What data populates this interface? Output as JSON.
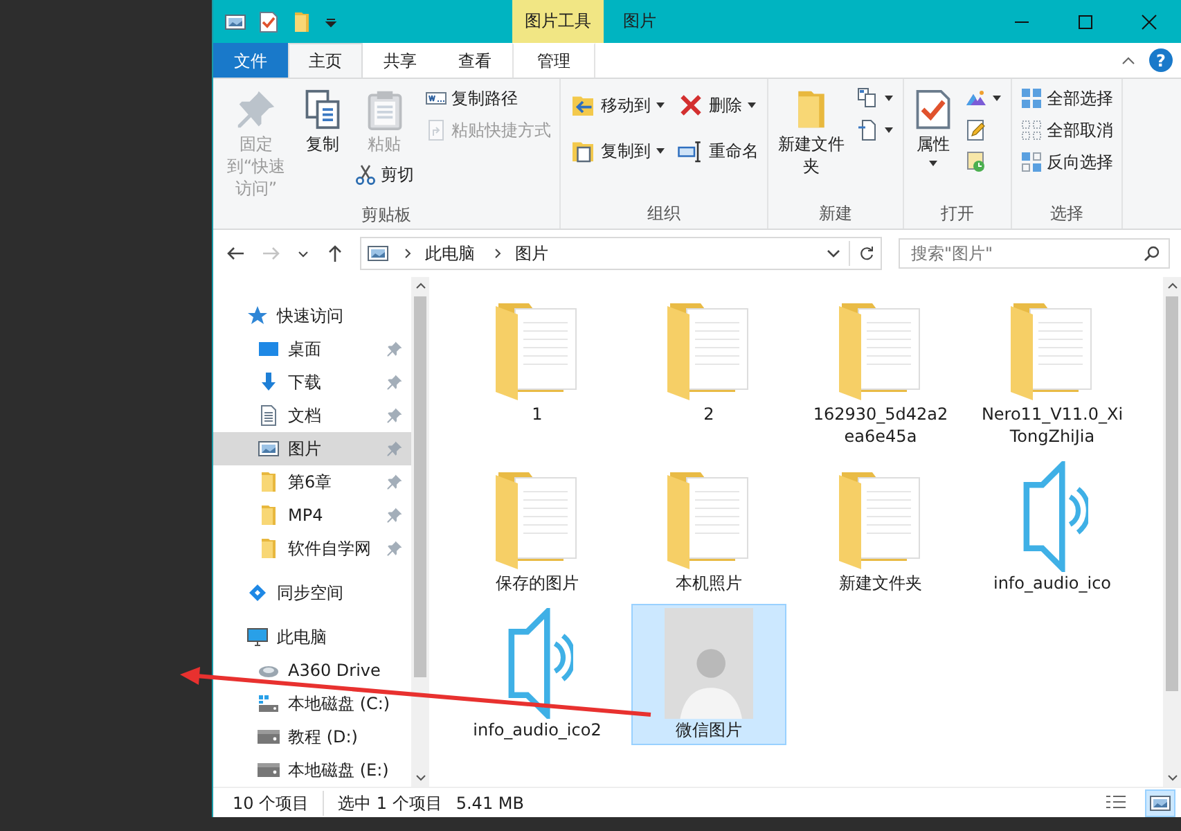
{
  "window": {
    "title": "图片",
    "context_tab": "图片工具"
  },
  "ribbon_tabs": [
    {
      "label": "文件",
      "kind": "file",
      "selected": false
    },
    {
      "label": "主页",
      "kind": "normal",
      "selected": true
    },
    {
      "label": "共享",
      "kind": "normal",
      "selected": false
    },
    {
      "label": "查看",
      "kind": "normal",
      "selected": false
    },
    {
      "label": "管理",
      "kind": "context",
      "selected": false
    }
  ],
  "help_button": {
    "label": "?"
  },
  "ribbon_groups": [
    {
      "label": "剪贴板",
      "columns": [
        [
          {
            "label": "固定到“快速访问”",
            "kind": "large",
            "disabled": true,
            "dropdown": false
          }
        ],
        [
          {
            "label": "复制",
            "kind": "large",
            "disabled": false,
            "dropdown": false
          }
        ],
        [
          {
            "label": "粘贴",
            "kind": "large",
            "disabled": true,
            "dropdown": false
          },
          {
            "label": "剪切",
            "kind": "small",
            "disabled": false,
            "dropdown": false
          }
        ],
        [
          {
            "label": "复制路径",
            "kind": "small",
            "disabled": false,
            "dropdown": false
          },
          {
            "label": "粘贴快捷方式",
            "kind": "small",
            "disabled": true,
            "dropdown": false
          }
        ]
      ]
    },
    {
      "label": "组织",
      "columns": [
        [
          {
            "label": "移动到",
            "kind": "medium",
            "disabled": false,
            "dropdown": true
          },
          {
            "label": "复制到",
            "kind": "medium",
            "disabled": false,
            "dropdown": true
          }
        ],
        [
          {
            "label": "删除",
            "kind": "medium",
            "disabled": false,
            "dropdown": true
          },
          {
            "label": "重命名",
            "kind": "medium",
            "disabled": false,
            "dropdown": false
          }
        ]
      ]
    },
    {
      "label": "新建",
      "columns": [
        [
          {
            "label": "新建文件夹",
            "kind": "large",
            "disabled": false,
            "dropdown": false
          }
        ],
        [
          {
            "kind": "small",
            "disabled": false,
            "dropdown": true
          },
          {
            "kind": "small",
            "disabled": false,
            "dropdown": true
          }
        ]
      ]
    },
    {
      "label": "打开",
      "columns": [
        [
          {
            "label": "属性",
            "kind": "large",
            "disabled": false,
            "dropdown": true
          }
        ],
        [
          {
            "kind": "small",
            "disabled": false,
            "dropdown": true
          },
          {
            "kind": "small",
            "disabled": false,
            "dropdown": false
          },
          {
            "kind": "small",
            "disabled": false,
            "dropdown": false
          }
        ]
      ]
    },
    {
      "label": "选择",
      "columns": [
        [
          {
            "label": "全部选择",
            "kind": "small",
            "disabled": false,
            "dropdown": false
          },
          {
            "label": "全部取消",
            "kind": "small",
            "disabled": false,
            "dropdown": false
          },
          {
            "label": "反向选择",
            "kind": "small",
            "disabled": false,
            "dropdown": false
          }
        ]
      ]
    }
  ],
  "address_bar": {
    "crumbs": [
      "此电脑",
      "图片"
    ]
  },
  "search": {
    "placeholder": "搜索\"图片\""
  },
  "nav_tree": [
    {
      "label": "快速访问",
      "kind": "quick-access",
      "selected": false,
      "children": [
        {
          "label": "桌面",
          "kind": "desktop",
          "selected": false,
          "pinned": true
        },
        {
          "label": "下载",
          "kind": "download",
          "selected": false,
          "pinned": true
        },
        {
          "label": "文档",
          "kind": "document",
          "selected": false,
          "pinned": true
        },
        {
          "label": "图片",
          "kind": "pictures",
          "selected": true,
          "pinned": true
        },
        {
          "label": "第6章",
          "kind": "folder",
          "selected": false,
          "pinned": true
        },
        {
          "label": "MP4",
          "kind": "folder",
          "selected": false,
          "pinned": true
        },
        {
          "label": "软件自学网",
          "kind": "folder",
          "selected": false,
          "pinned": true
        }
      ]
    },
    {
      "label": "同步空间",
      "kind": "sync",
      "selected": false
    },
    {
      "label": "此电脑",
      "kind": "pc",
      "selected": false,
      "children": [
        {
          "label": "A360 Drive",
          "kind": "cloud-drive",
          "selected": false
        },
        {
          "label": "本地磁盘 (C:)",
          "kind": "system-drive",
          "selected": false
        },
        {
          "label": "教程 (D:)",
          "kind": "drive",
          "selected": false
        },
        {
          "label": "本地磁盘 (E:)",
          "kind": "drive",
          "selected": false
        }
      ]
    }
  ],
  "files": [
    {
      "name": "1",
      "kind": "folder",
      "selected": false
    },
    {
      "name": "2",
      "kind": "folder",
      "selected": false
    },
    {
      "name": "162930_5d42a2ea6e45a",
      "kind": "folder",
      "selected": false
    },
    {
      "name": "Nero11_V11.0_XiTongZhiJia",
      "kind": "folder",
      "selected": false
    },
    {
      "name": "保存的图片",
      "kind": "folder",
      "selected": false
    },
    {
      "name": "本机照片",
      "kind": "folder",
      "selected": false
    },
    {
      "name": "新建文件夹",
      "kind": "folder",
      "selected": false
    },
    {
      "name": "info_audio_ico",
      "kind": "audio",
      "selected": false
    },
    {
      "name": "info_audio_ico2",
      "kind": "audio",
      "selected": false
    },
    {
      "name": "微信图片",
      "kind": "image",
      "selected": true
    }
  ],
  "status_bar": {
    "item_count": "10 个项目",
    "selection": "选中 1 个项目",
    "size": "5.41 MB"
  },
  "view_buttons": [
    {
      "kind": "details",
      "selected": false
    },
    {
      "kind": "large-icons",
      "selected": true
    }
  ]
}
